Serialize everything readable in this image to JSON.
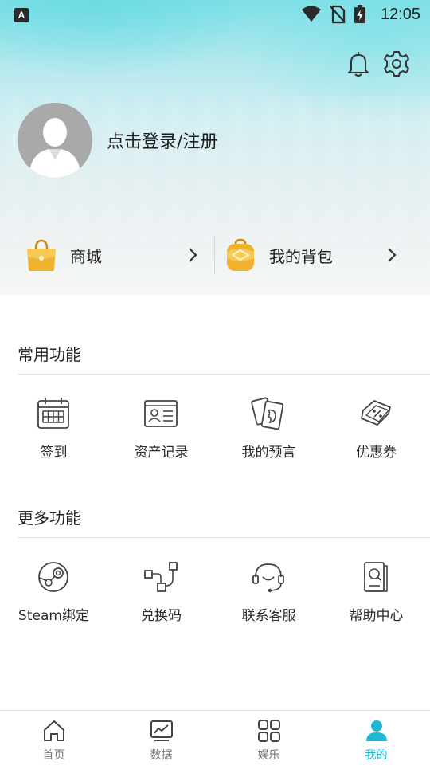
{
  "status_bar": {
    "app_indicator": "A",
    "time": "12:05",
    "icons": [
      "wifi-icon",
      "no-sim-icon",
      "battery-charging-icon"
    ]
  },
  "header": {
    "login_text": "点击登录/注册",
    "actions": [
      "bell-icon",
      "gear-icon"
    ]
  },
  "quick_links": [
    {
      "label": "商城",
      "icon": "shopping-bag-icon"
    },
    {
      "label": "我的背包",
      "icon": "backpack-icon"
    }
  ],
  "sections": [
    {
      "title": "常用功能",
      "items": [
        {
          "label": "签到",
          "icon": "calendar-icon"
        },
        {
          "label": "资产记录",
          "icon": "id-card-icon"
        },
        {
          "label": "我的预言",
          "icon": "cards-icon"
        },
        {
          "label": "优惠券",
          "icon": "coupon-icon"
        }
      ]
    },
    {
      "title": "更多功能",
      "items": [
        {
          "label": "Steam绑定",
          "icon": "steam-icon"
        },
        {
          "label": "兑换码",
          "icon": "exchange-nodes-icon"
        },
        {
          "label": "联系客服",
          "icon": "headset-icon"
        },
        {
          "label": "帮助中心",
          "icon": "help-book-icon"
        }
      ]
    }
  ],
  "bottom_nav": [
    {
      "label": "首页",
      "icon": "home-icon",
      "active": false
    },
    {
      "label": "数据",
      "icon": "chart-icon",
      "active": false
    },
    {
      "label": "娱乐",
      "icon": "grid-icon",
      "active": false
    },
    {
      "label": "我的",
      "icon": "user-icon",
      "active": true
    }
  ],
  "colors": {
    "accent": "#1fb9d6",
    "gold": "#e9a824",
    "text": "#222222",
    "nav_inactive": "#777777"
  }
}
